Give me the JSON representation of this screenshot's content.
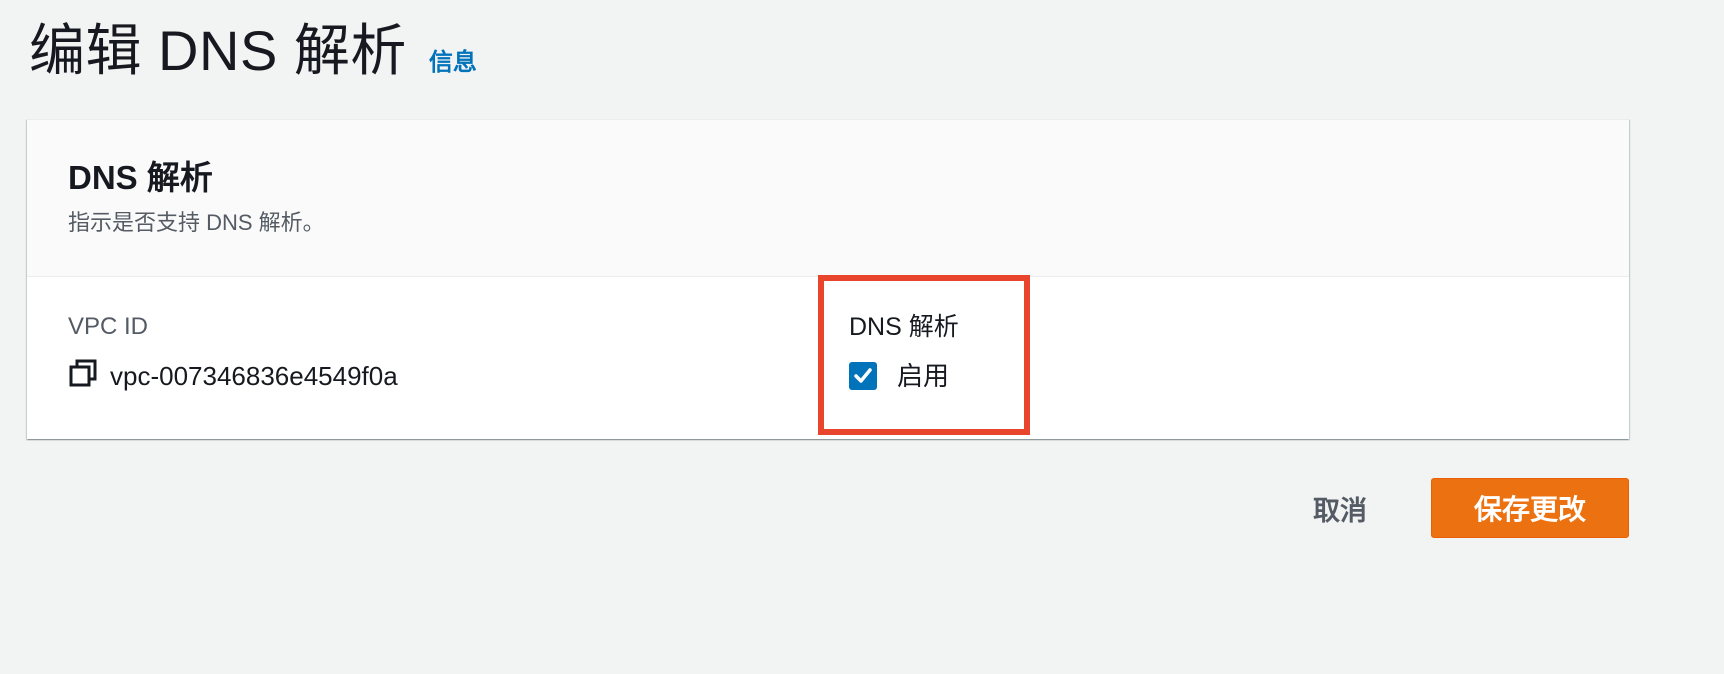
{
  "header": {
    "title": "编辑 DNS 解析",
    "info_link": "信息"
  },
  "panel": {
    "title": "DNS 解析",
    "description": "指示是否支持 DNS 解析。",
    "vpc_field": {
      "label": "VPC ID",
      "value": "vpc-007346836e4549f0a",
      "icon": "copy-icon"
    },
    "dns_field": {
      "label": "DNS 解析",
      "checkbox_label": "启用",
      "checked": true
    }
  },
  "actions": {
    "cancel_label": "取消",
    "save_label": "保存更改"
  },
  "colors": {
    "accent": "#0073bb",
    "primary_button": "#ec7211",
    "highlight": "#e8452c",
    "background": "#f2f3f3"
  }
}
